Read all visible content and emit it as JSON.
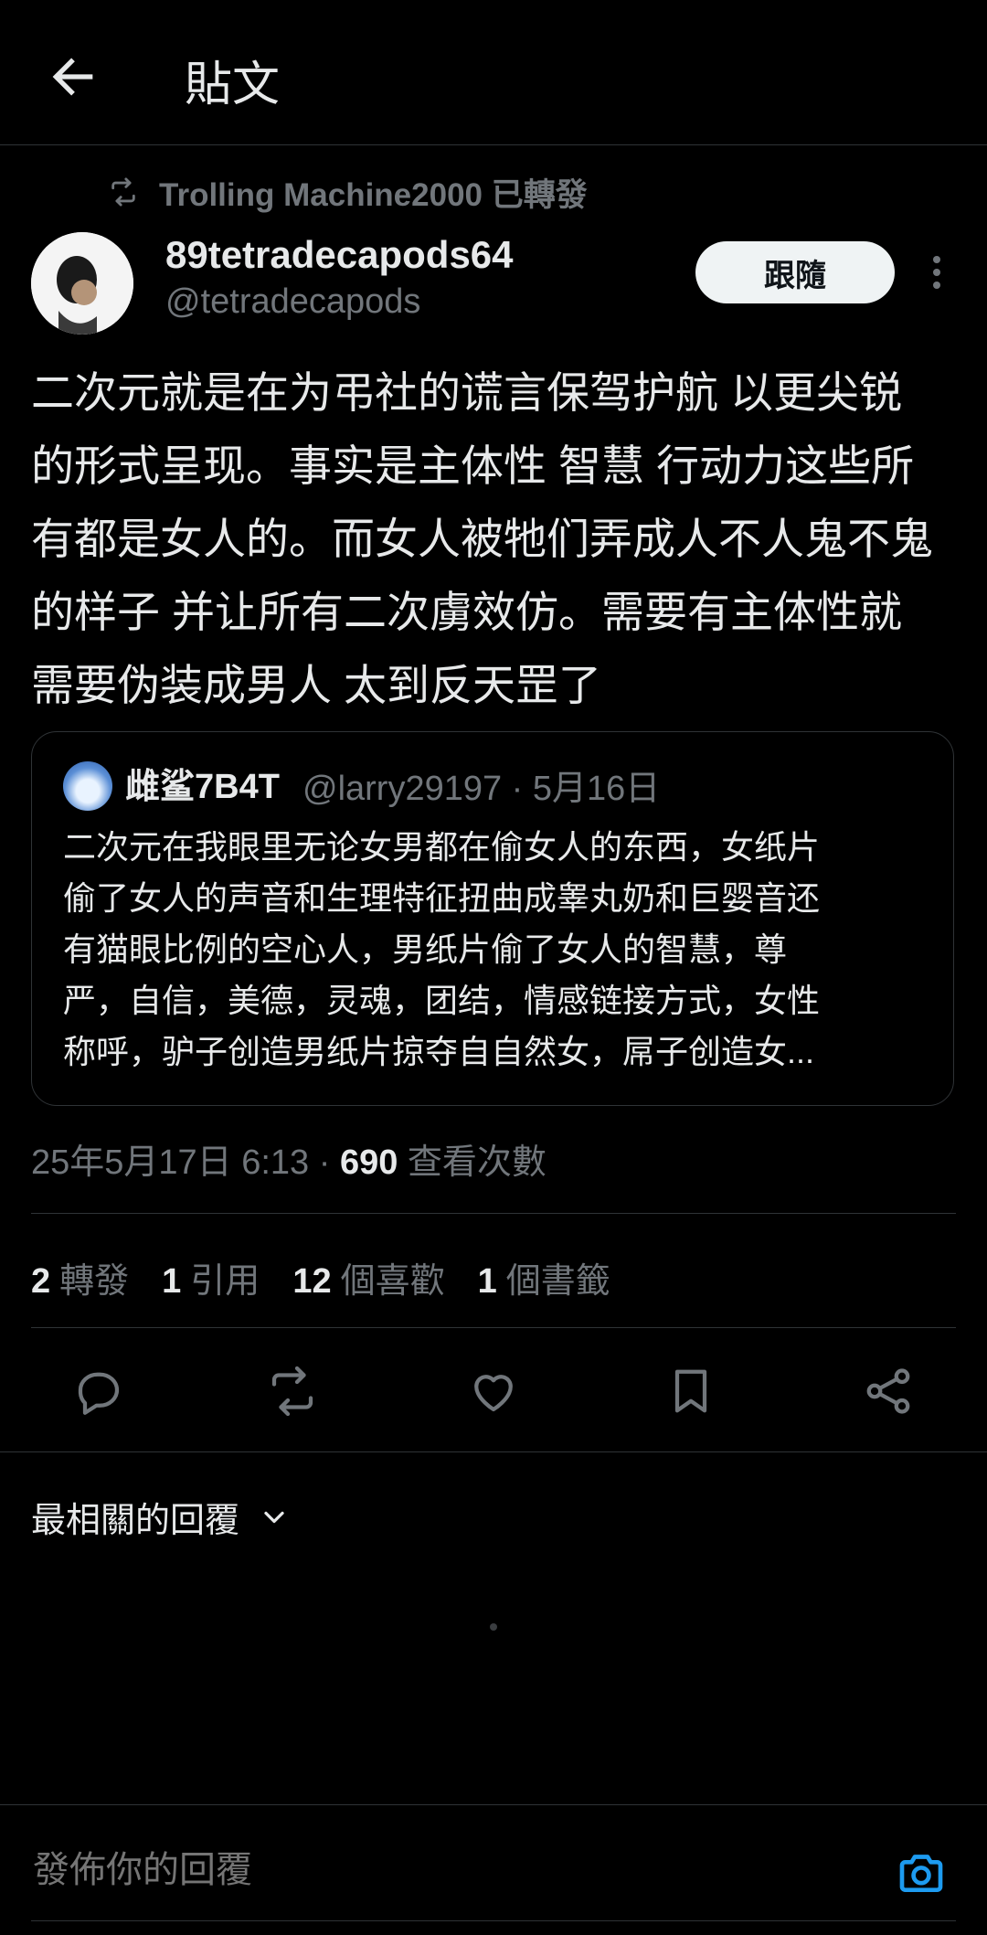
{
  "header": {
    "title": "貼文"
  },
  "retweet": {
    "label": "Trolling Machine2000 已轉發"
  },
  "author": {
    "display_name": "89tetradecapods64",
    "handle": "@tetradecapods",
    "follow_label": "跟隨"
  },
  "tweet": {
    "lines": [
      "二次元就是在为弔社的谎言保驾护航 以更尖锐",
      "的形式呈现。事实是主体性 智慧 行动力这些所",
      "有都是女人的。而女人被牠们弄成人不人鬼不鬼",
      "的样子 并让所有二次虜效仿。需要有主体性就",
      "需要伪装成男人 太到反天罡了"
    ]
  },
  "quote": {
    "name": "雌鲨7B4T",
    "meta": "@larry29197 · 5月16日",
    "lines": [
      "二次元在我眼里无论女男都在偷女人的东西，女纸片",
      "偷了女人的声音和生理特征扭曲成睾丸奶和巨婴音还",
      "有猫眼比例的空心人，男纸片偷了女人的智慧，尊",
      "严，自信，美德，灵魂，团结，情感链接方式，女性",
      "称呼，驴子创造男纸片掠夺自自然女，屌子创造女..."
    ]
  },
  "meta": {
    "timestamp": "25年5月17日 6:13 · ",
    "views_count": "690",
    "views_label": " 查看次數"
  },
  "stats": {
    "retweets_count": "2",
    "retweets_label": "轉發",
    "quotes_count": "1",
    "quotes_label": "引用",
    "likes_count": "12",
    "likes_label": "個喜歡",
    "bookmarks_count": "1",
    "bookmarks_label": "個書籤"
  },
  "replies": {
    "sort_label": "最相關的回覆"
  },
  "reply_bar": {
    "placeholder": "發佈你的回覆"
  },
  "colors": {
    "accent": "#1d9bf0",
    "background": "#000000",
    "muted": "#71767b",
    "text": "#e7e9ea"
  },
  "icons": [
    "back-arrow-icon",
    "retweet-icon",
    "more-vertical-icon",
    "reply-icon",
    "retweet-icon",
    "like-icon",
    "bookmark-icon",
    "share-icon",
    "chevron-down-icon",
    "camera-icon"
  ]
}
